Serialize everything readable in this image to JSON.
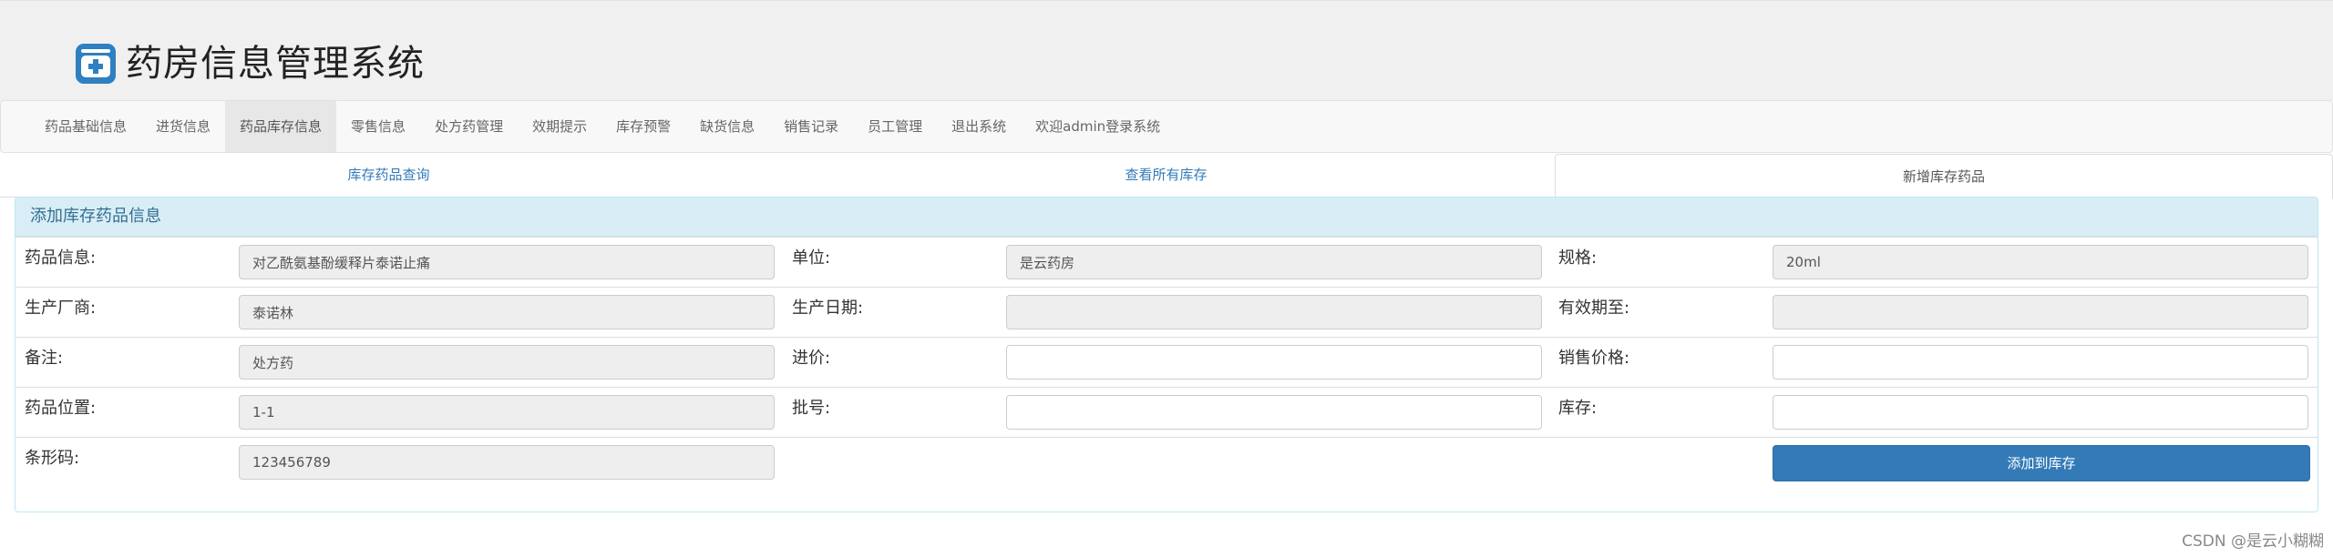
{
  "app": {
    "title": "药房信息管理系统"
  },
  "nav": {
    "items": [
      {
        "label": "药品基础信息"
      },
      {
        "label": "进货信息"
      },
      {
        "label": "药品库存信息",
        "active": true
      },
      {
        "label": "零售信息"
      },
      {
        "label": "处方药管理"
      },
      {
        "label": "效期提示"
      },
      {
        "label": "库存预警"
      },
      {
        "label": "缺货信息"
      },
      {
        "label": "销售记录"
      },
      {
        "label": "员工管理"
      },
      {
        "label": "退出系统"
      },
      {
        "label": "欢迎admin登录系统"
      }
    ]
  },
  "tabs": [
    {
      "label": "库存药品查询"
    },
    {
      "label": "查看所有库存"
    },
    {
      "label": "新增库存药品",
      "active": true
    }
  ],
  "form": {
    "heading": "添加库存药品信息",
    "fields": {
      "drug_info": {
        "label": "药品信息:",
        "value": "对乙酰氨基酚缓释片泰诺止痛"
      },
      "unit": {
        "label": "单位:",
        "value": "是云药房"
      },
      "spec": {
        "label": "规格:",
        "value": "20ml"
      },
      "manufacturer": {
        "label": "生产厂商:",
        "value": "泰诺林"
      },
      "production_date": {
        "label": "生产日期:",
        "value": ""
      },
      "expiry_date": {
        "label": "有效期至:",
        "value": ""
      },
      "remark": {
        "label": "备注:",
        "value": "处方药"
      },
      "purchase_price": {
        "label": "进价:",
        "value": ""
      },
      "sale_price": {
        "label": "销售价格:",
        "value": ""
      },
      "location": {
        "label": "药品位置:",
        "value": "1-1"
      },
      "batch_no": {
        "label": "批号:",
        "value": ""
      },
      "stock": {
        "label": "库存:",
        "value": ""
      },
      "barcode": {
        "label": "条形码:",
        "value": "123456789"
      }
    },
    "submit_label": "添加到库存"
  },
  "colors": {
    "primary": "#337ab7",
    "panel_heading_bg": "#d9edf7",
    "panel_heading_text": "#31708f"
  },
  "watermark": "CSDN @是云小糊糊"
}
